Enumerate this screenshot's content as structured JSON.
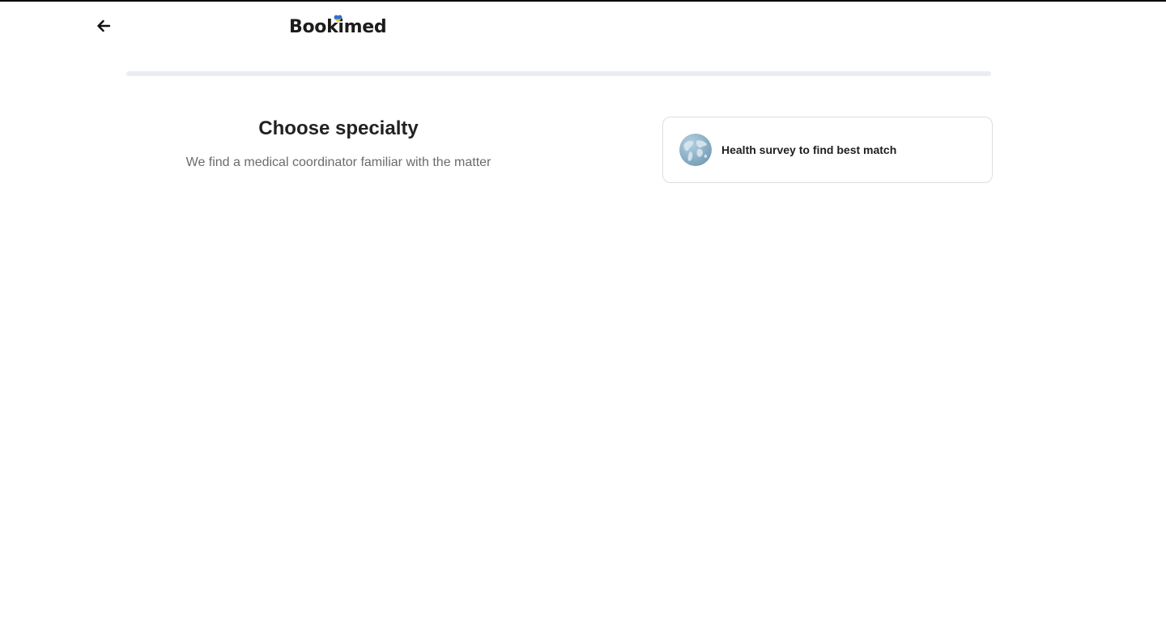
{
  "header": {
    "back_icon": "arrow-left-icon",
    "logo_text": "Bookimed",
    "logo_accent_icon": "ukraine-heart-icon",
    "logo_accent_colors": [
      "#2f6fd6",
      "#f5c518"
    ]
  },
  "progress": {
    "value": 0,
    "track_color": "#e9edf2"
  },
  "main": {
    "title": "Choose specialty",
    "subtitle": "We find a medical coordinator familiar with the matter"
  },
  "survey_card": {
    "icon": "globe-icon",
    "label": "Health survey to find best match"
  }
}
